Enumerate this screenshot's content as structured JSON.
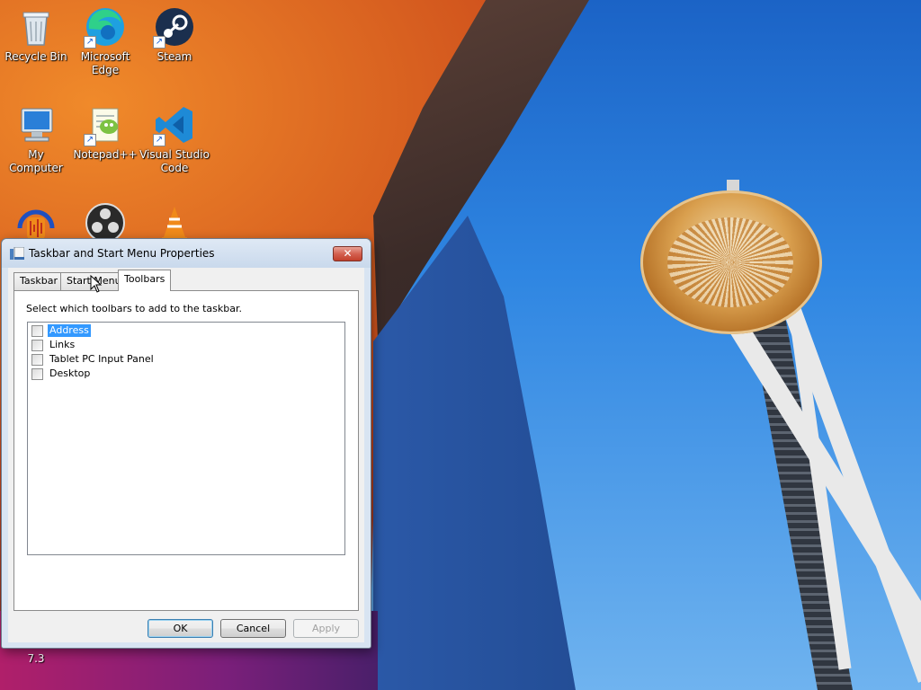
{
  "desktop": {
    "icons": [
      {
        "label": "Recycle Bin",
        "icon": "recycle-bin-icon"
      },
      {
        "label": "Microsoft Edge",
        "icon": "edge-icon"
      },
      {
        "label": "Steam",
        "icon": "steam-icon"
      },
      {
        "label": "My Computer",
        "icon": "computer-icon"
      },
      {
        "label": "Notepad++",
        "icon": "notepadpp-icon"
      },
      {
        "label": "Visual Studio Code",
        "icon": "vscode-icon"
      },
      {
        "label": "",
        "icon": "audacity-icon"
      },
      {
        "label": "",
        "icon": "obs-icon"
      },
      {
        "label": "",
        "icon": "vlc-icon"
      }
    ],
    "partial_label": "7.3"
  },
  "dialog": {
    "title": "Taskbar and Start Menu Properties",
    "close_symbol": "✕",
    "tabs": [
      {
        "label": "Taskbar",
        "active": false
      },
      {
        "label": "Start Menu",
        "active": false
      },
      {
        "label": "Toolbars",
        "active": true
      }
    ],
    "instruction": "Select which toolbars to add to the taskbar.",
    "toolbars": [
      {
        "label": "Address",
        "checked": false,
        "selected": true
      },
      {
        "label": "Links",
        "checked": false,
        "selected": false
      },
      {
        "label": "Tablet PC Input Panel",
        "checked": false,
        "selected": false
      },
      {
        "label": "Desktop",
        "checked": false,
        "selected": false
      }
    ],
    "buttons": {
      "ok": "OK",
      "cancel": "Cancel",
      "apply": "Apply"
    }
  },
  "colors": {
    "selection": "#3399ff",
    "close_button": "#c2402c"
  }
}
